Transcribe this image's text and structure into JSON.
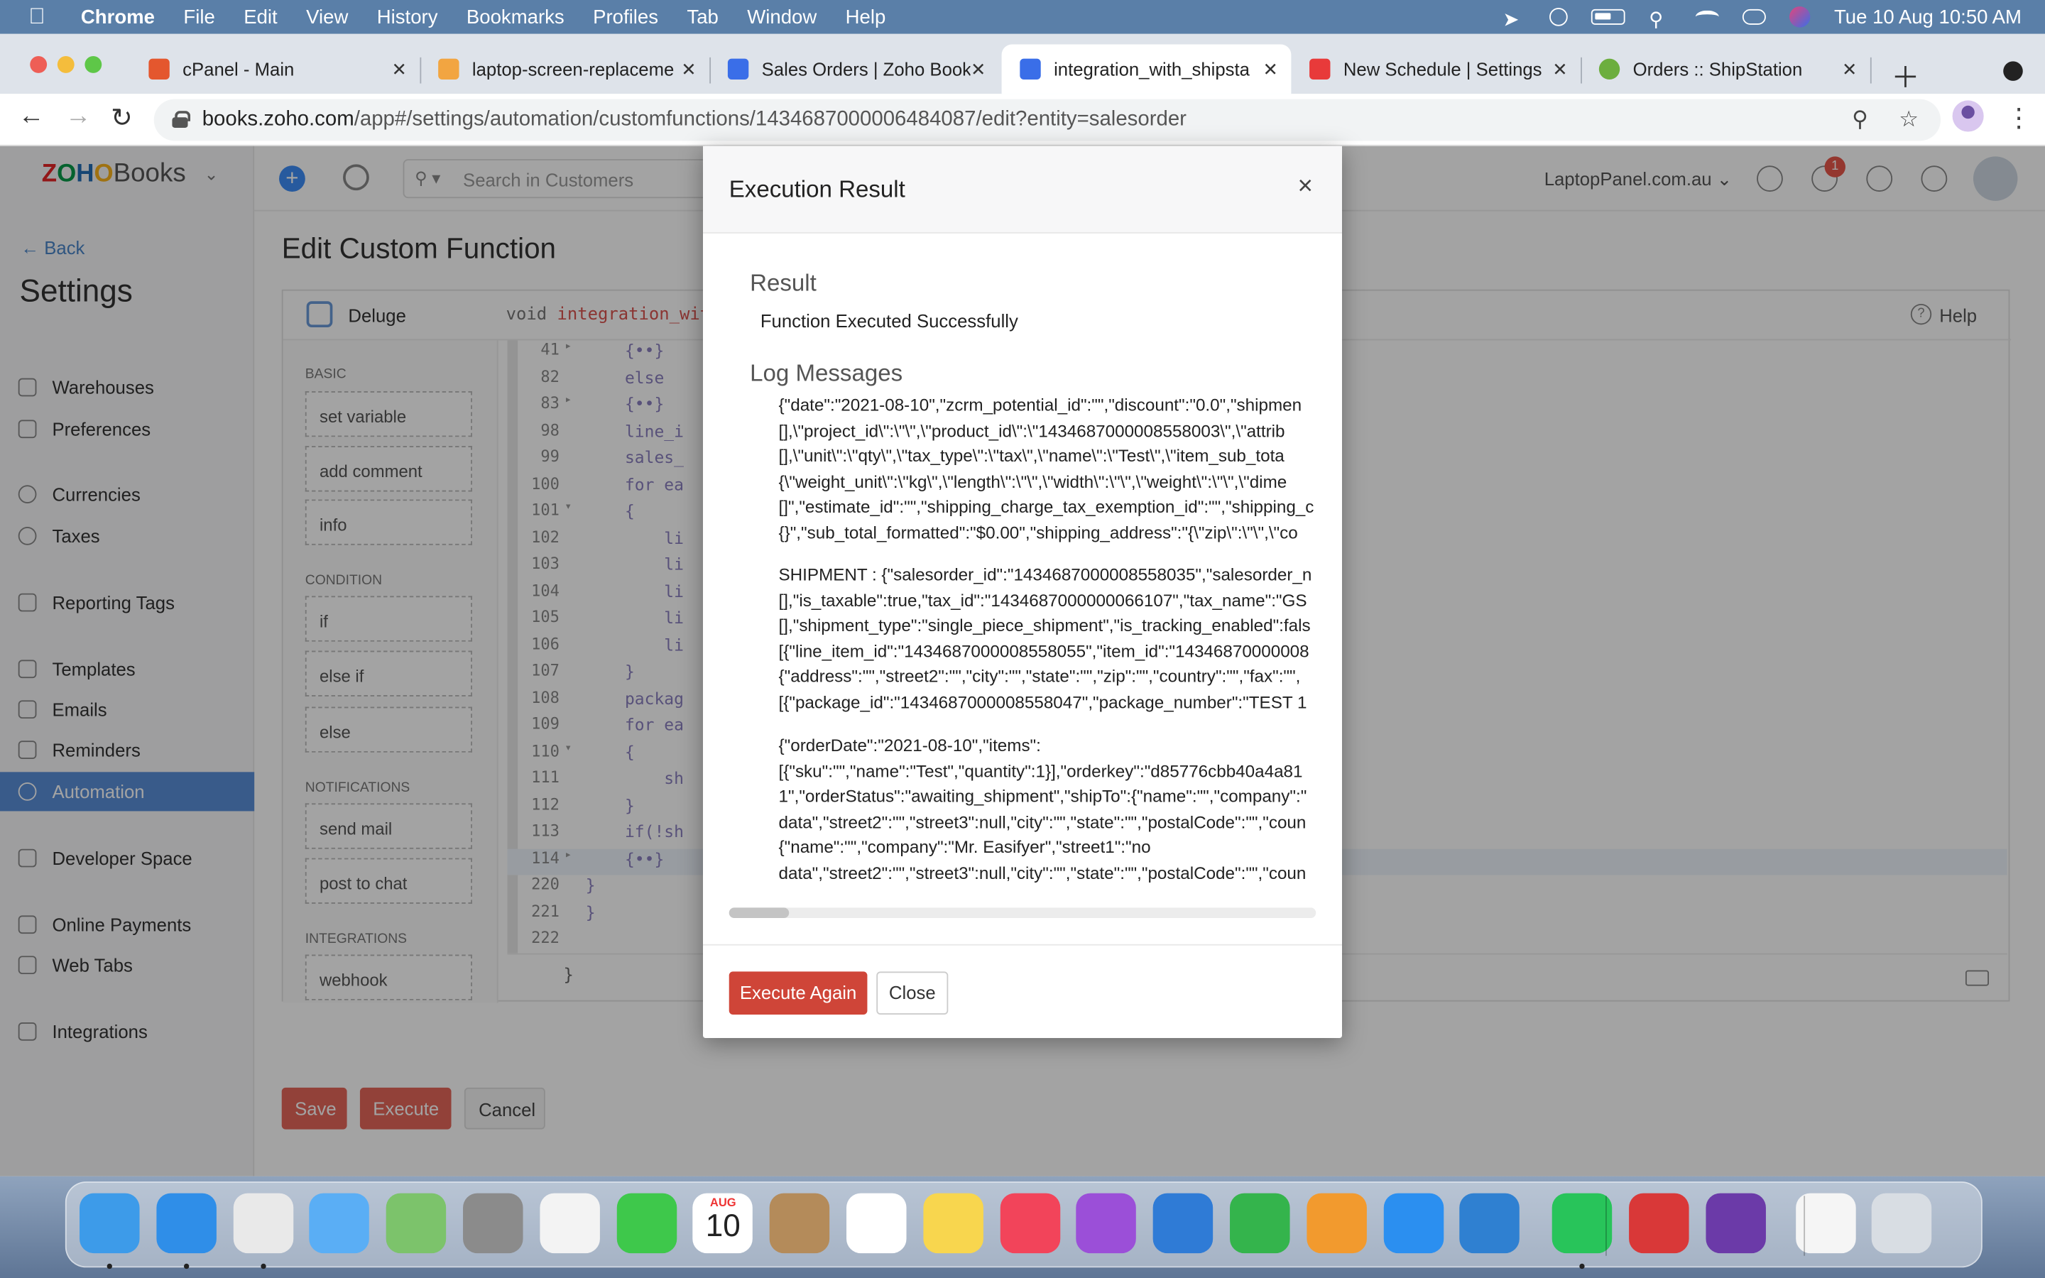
{
  "menubar": {
    "app_name": "Chrome",
    "menus": [
      "File",
      "Edit",
      "View",
      "History",
      "Bookmarks",
      "Profiles",
      "Tab",
      "Window",
      "Help"
    ],
    "datetime": "Tue 10 Aug  10:50 AM"
  },
  "tabs": [
    {
      "label": "cPanel - Main",
      "favicon_color": "#e4572e"
    },
    {
      "label": "laptop-screen-replaceme",
      "favicon_color": "#f2a541"
    },
    {
      "label": "Sales Orders | Zoho Book",
      "favicon_color": "#3a6ee8"
    },
    {
      "label": "integration_with_shipsta",
      "favicon_color": "#3a6ee8"
    },
    {
      "label": "New Schedule | Settings",
      "favicon_color": "#e83a3a"
    },
    {
      "label": "Orders :: ShipStation",
      "favicon_color": "#6cae3e"
    }
  ],
  "address": {
    "domain": "books.zoho.com",
    "path": "/app#/settings/automation/customfunctions/1434687000006484087/edit?entity=salesorder"
  },
  "app": {
    "logo_text": "Books",
    "logo_letters": [
      "Z",
      "O",
      "H",
      "O"
    ],
    "logo_colors": [
      "#e42527",
      "#089949",
      "#226db4",
      "#f9b21d"
    ],
    "search_placeholder": "Search in Customers",
    "organization": "LaptopPanel.com.au",
    "notification_count": "1",
    "back_label": "Back",
    "settings_title": "Settings",
    "sidebar": [
      {
        "label": "Warehouses",
        "icon": "warehouse-icon"
      },
      {
        "label": "Preferences",
        "icon": "preferences-icon"
      },
      {
        "label": "Currencies",
        "icon": "currency-icon"
      },
      {
        "label": "Taxes",
        "icon": "tax-icon"
      },
      {
        "label": "Reporting Tags",
        "icon": "tag-icon"
      },
      {
        "label": "Templates",
        "icon": "template-icon"
      },
      {
        "label": "Emails",
        "icon": "email-icon"
      },
      {
        "label": "Reminders",
        "icon": "bell-icon"
      },
      {
        "label": "Automation",
        "icon": "automation-icon",
        "active": true
      },
      {
        "label": "Developer Space",
        "icon": "code-icon"
      },
      {
        "label": "Online Payments",
        "icon": "payment-icon"
      },
      {
        "label": "Web Tabs",
        "icon": "webtab-icon"
      },
      {
        "label": "Integrations",
        "icon": "integration-icon"
      }
    ],
    "page_title": "Edit Custom Function",
    "editor": {
      "language": "Deluge",
      "signature_prefix": "void ",
      "signature_name": "integration_with_",
      "help_label": "Help",
      "palette": {
        "basic_label": "BASIC",
        "basic": [
          "set variable",
          "add comment",
          "info"
        ],
        "condition_label": "CONDITION",
        "condition": [
          "if",
          "else if",
          "else"
        ],
        "notifications_label": "NOTIFICATIONS",
        "notifications": [
          "send mail",
          "post to chat"
        ],
        "integrations_label": "INTEGRATIONS",
        "integrations": [
          "webhook"
        ]
      },
      "lines": [
        {
          "num": "41",
          "text": "    {••}",
          "fold": "▸"
        },
        {
          "num": "82",
          "text": "    else",
          "fold": ""
        },
        {
          "num": "83",
          "text": "    {••}",
          "fold": "▸"
        },
        {
          "num": "98",
          "text": "    line_i",
          "fold": ""
        },
        {
          "num": "99",
          "text": "    sales_",
          "fold": ""
        },
        {
          "num": "100",
          "text": "    for ea",
          "fold": ""
        },
        {
          "num": "101",
          "text": "    {",
          "fold": "▾"
        },
        {
          "num": "102",
          "text": "        li",
          "fold": ""
        },
        {
          "num": "103",
          "text": "        li",
          "fold": ""
        },
        {
          "num": "104",
          "text": "        li",
          "fold": ""
        },
        {
          "num": "105",
          "text": "        li",
          "fold": ""
        },
        {
          "num": "106",
          "text": "        li",
          "fold": ""
        },
        {
          "num": "107",
          "text": "    }",
          "fold": ""
        },
        {
          "num": "108",
          "text": "    packag",
          "fold": ""
        },
        {
          "num": "109",
          "text": "    for ea",
          "fold": ""
        },
        {
          "num": "110",
          "text": "    {",
          "fold": "▾"
        },
        {
          "num": "111",
          "text": "        sh",
          "fold": ""
        },
        {
          "num": "112",
          "text": "    }",
          "fold": ""
        },
        {
          "num": "113",
          "text": "    if(!sh",
          "fold": ""
        },
        {
          "num": "114",
          "text": "    {••}",
          "fold": "▸",
          "highlight": true
        },
        {
          "num": "220",
          "text": "}",
          "fold": ""
        },
        {
          "num": "221",
          "text": "}",
          "fold": ""
        },
        {
          "num": "222",
          "text": "",
          "fold": ""
        }
      ],
      "closing_brace": "}"
    },
    "buttons": {
      "save": "Save",
      "execute": "Execute",
      "cancel": "Cancel"
    }
  },
  "modal": {
    "title": "Execution Result",
    "close_glyph": "×",
    "result_heading": "Result",
    "result_text": "Function Executed Successfully",
    "log_heading": "Log Messages",
    "log_blocks": [
      [
        "{\"date\":\"2021-08-10\",\"zcrm_potential_id\":\"\",\"discount\":\"0.0\",\"shipmen",
        "[],\\\"project_id\\\":\\\"\\\",\\\"product_id\\\":\\\"1434687000008558003\\\",\\\"attrib",
        "[],\\\"unit\\\":\\\"qty\\\",\\\"tax_type\\\":\\\"tax\\\",\\\"name\\\":\\\"Test\\\",\\\"item_sub_tota",
        "{\\\"weight_unit\\\":\\\"kg\\\",\\\"length\\\":\\\"\\\",\\\"width\\\":\\\"\\\",\\\"weight\\\":\\\"\\\",\\\"dime",
        "[]\",\"estimate_id\":\"\",\"shipping_charge_tax_exemption_id\":\"\",\"shipping_c",
        "{}\",\"sub_total_formatted\":\"$0.00\",\"shipping_address\":\"{\\\"zip\\\":\\\"\\\",\\\"co"
      ],
      [
        "SHIPMENT : {\"salesorder_id\":\"1434687000008558035\",\"salesorder_n",
        "[],\"is_taxable\":true,\"tax_id\":\"1434687000000066107\",\"tax_name\":\"GS",
        "[],\"shipment_type\":\"single_piece_shipment\",\"is_tracking_enabled\":fals",
        "[{\"line_item_id\":\"1434687000008558055\",\"item_id\":\"14346870000008",
        "{\"address\":\"\",\"street2\":\"\",\"city\":\"\",\"state\":\"\",\"zip\":\"\",\"country\":\"\",\"fax\":\"\",",
        "[{\"package_id\":\"1434687000008558047\",\"package_number\":\"TEST 1"
      ],
      [
        "{\"orderDate\":\"2021-08-10\",\"items\":",
        "[{\"sku\":\"\",\"name\":\"Test\",\"quantity\":1}],\"orderkey\":\"d85776cbb40a4a81",
        "1\",\"orderStatus\":\"awaiting_shipment\",\"shipTo\":{\"name\":\"\",\"company\":\"",
        "data\",\"street2\":\"\",\"street3\":null,\"city\":\"\",\"state\":\"\",\"postalCode\":\"\",\"coun",
        "{\"name\":\"\",\"company\":\"Mr. Easifyer\",\"street1\":\"no",
        "data\",\"street2\":\"\",\"street3\":null,\"city\":\"\",\"state\":\"\",\"postalCode\":\"\",\"coun"
      ]
    ],
    "execute_again": "Execute Again",
    "close": "Close"
  },
  "dock": {
    "calendar_month": "AUG",
    "calendar_day": "10",
    "apps": [
      {
        "name": "finder-icon",
        "color": "#3d9be9"
      },
      {
        "name": "safari-icon",
        "color": "#2f8ee8"
      },
      {
        "name": "chrome-icon",
        "color": "#e9e9e9"
      },
      {
        "name": "mail-icon",
        "color": "#5aaef5"
      },
      {
        "name": "maps-icon",
        "color": "#7cc36b"
      },
      {
        "name": "system-preferences-icon",
        "color": "#8b8b8b"
      },
      {
        "name": "photos-icon",
        "color": "#f3f3f3"
      },
      {
        "name": "facetime-icon",
        "color": "#3ec84b"
      },
      {
        "name": "calendar-icon",
        "color": "#ffffff"
      },
      {
        "name": "contacts-icon",
        "color": "#b48b5a"
      },
      {
        "name": "reminders-icon",
        "color": "#ffffff"
      },
      {
        "name": "notes-icon",
        "color": "#f8d64e"
      },
      {
        "name": "music-icon",
        "color": "#f2445a"
      },
      {
        "name": "podcasts-icon",
        "color": "#9b4fd8"
      },
      {
        "name": "keynote-icon",
        "color": "#2f7bd6"
      },
      {
        "name": "numbers-icon",
        "color": "#34b44c"
      },
      {
        "name": "pages-icon",
        "color": "#f29a2e"
      },
      {
        "name": "app-store-icon",
        "color": "#2b8ff0"
      },
      {
        "name": "vscode-icon",
        "color": "#2f80d1"
      },
      {
        "name": "whatsapp-icon",
        "color": "#28c45a"
      },
      {
        "name": "photo-booth-icon",
        "color": "#d93838"
      },
      {
        "name": "tor-icon",
        "color": "#6b3aa8"
      },
      {
        "name": "screenshot-thumbnail-icon",
        "color": "#f5f5f5"
      },
      {
        "name": "trash-icon",
        "color": "#d8dde3"
      }
    ]
  }
}
